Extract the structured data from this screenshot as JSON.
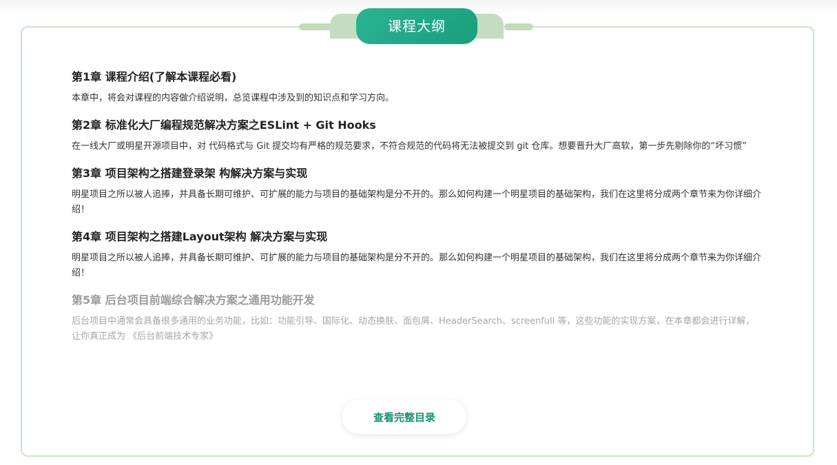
{
  "header": {
    "tab_title": "课程大纲"
  },
  "chapters": [
    {
      "title": "第1章 课程介绍(了解本课程必看)",
      "desc": "本章中，将会对课程的内容做介绍说明，总览课程中涉及到的知识点和学习方向。"
    },
    {
      "title": "第2章 标准化大厂编程规范解决方案之ESLint + Git Hooks",
      "desc": "在一线大厂或明星开源项目中，对 代码格式与 Git 提交均有严格的规范要求，不符合规范的代码将无法被提交到 git 仓库。想要晋升大厂高软，第一步先剔除你的“坏习惯”"
    },
    {
      "title": "第3章 项目架构之搭建登录架 构解决方案与实现",
      "desc": "明星项目之所以被人追捧，并具备长期可维护、可扩展的能力与项目的基础架构是分不开的。那么如何构建一个明星项目的基础架构，我们在这里将分成两个章节来为你详细介绍！"
    },
    {
      "title": "第4章 项目架构之搭建Layout架构 解决方案与实现",
      "desc": "明星项目之所以被人追捧，并具备长期可维护、可扩展的能力与项目的基础架构是分不开的。那么如何构建一个明星项目的基础架构，我们在这里将分成两个章节来为你详细介绍！"
    },
    {
      "title": "第5章 后台项目前端综合解决方案之通用功能开发",
      "desc": "后台项目中通常会具备很多通用的业务功能，比如：功能引导、国际化、动态换肤、面包屑、HeaderSearch、screenfull 等，这些功能的实现方案，在本章都会进行详解，让你真正成为 《后台前端技术专家》"
    }
  ],
  "footer": {
    "more_label": "查看完整目录"
  },
  "colors": {
    "accent": "#1a9e7c",
    "border": "#c9e3c9",
    "tab_back": "#c4ddc0"
  }
}
